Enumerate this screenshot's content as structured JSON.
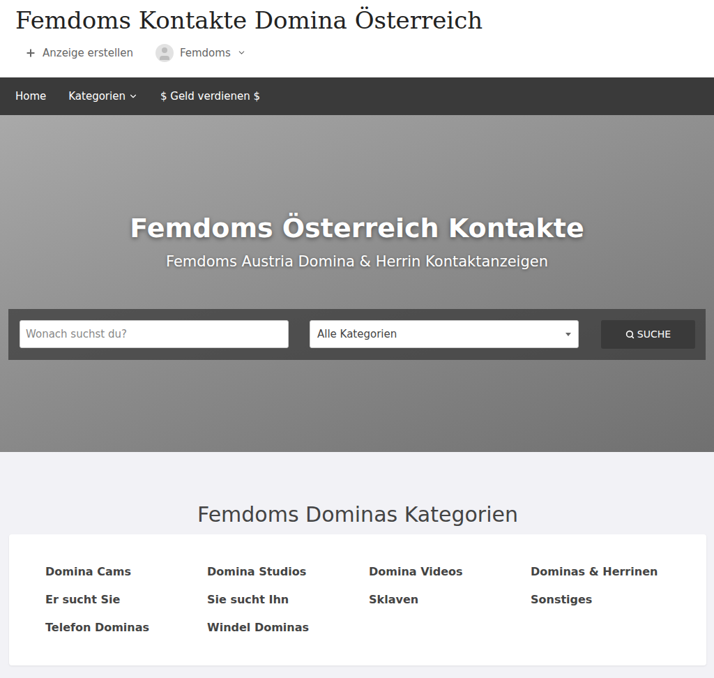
{
  "site": {
    "title": "Femdoms Kontakte Domina Österreich"
  },
  "header_actions": [
    {
      "label": "Anzeige erstellen",
      "kind": "create"
    },
    {
      "label": "Femdoms",
      "kind": "account"
    }
  ],
  "nav": [
    {
      "label": "Home",
      "dropdown": false
    },
    {
      "label": "Kategorien",
      "dropdown": true
    },
    {
      "label": "$ Geld verdienen $",
      "dropdown": false
    }
  ],
  "hero": {
    "title": "Femdoms Österreich Kontakte",
    "subtitle": "Femdoms Austria Domina & Herrin Kontaktanzeigen"
  },
  "search": {
    "placeholder": "Wonach suchst du?",
    "category": "Alle Kategorien",
    "button": "SUCHE"
  },
  "categories": {
    "heading": "Femdoms Dominas Kategorien",
    "items": [
      "Domina Cams",
      "Domina Studios",
      "Domina Videos",
      "Dominas & Herrinen",
      "Er sucht Sie",
      "Sie sucht Ihn",
      "Sklaven",
      "Sonstiges",
      "Telefon Dominas",
      "Windel Dominas"
    ]
  }
}
